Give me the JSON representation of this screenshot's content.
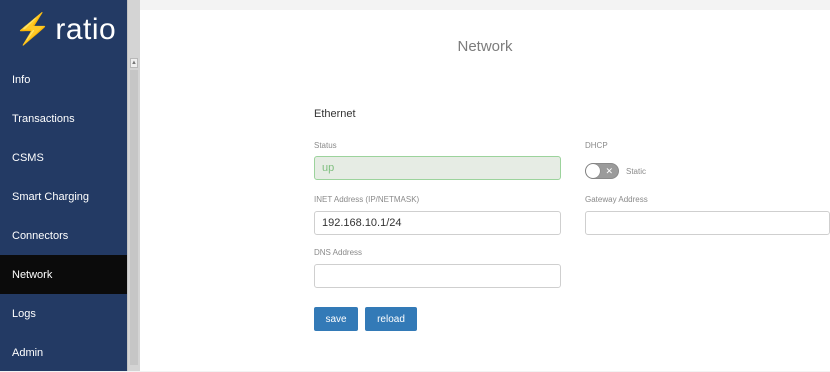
{
  "brand": {
    "bolt": "⚡",
    "name": "ratio"
  },
  "sidebar": {
    "items": [
      {
        "label": "Info"
      },
      {
        "label": "Transactions"
      },
      {
        "label": "CSMS"
      },
      {
        "label": "Smart Charging"
      },
      {
        "label": "Connectors"
      },
      {
        "label": "Network",
        "active": true
      },
      {
        "label": "Logs"
      },
      {
        "label": "Admin"
      }
    ]
  },
  "page": {
    "title": "Network"
  },
  "ethernet": {
    "section_title": "Ethernet",
    "status": {
      "label": "Status",
      "value": "up"
    },
    "dhcp": {
      "label": "DHCP",
      "toggle_label": "Static",
      "toggle_glyph": "✕",
      "enabled": false
    },
    "inet": {
      "label": "INET Address (IP/NETMASK)",
      "value": "192.168.10.1/24"
    },
    "gateway": {
      "label": "Gateway Address",
      "value": ""
    },
    "dns": {
      "label": "DNS Address",
      "value": ""
    }
  },
  "actions": {
    "save_label": "save",
    "reload_label": "reload"
  },
  "colors": {
    "sidebar_bg": "#233a64",
    "active_bg": "#0b0b0b",
    "button_bg": "#337ab7",
    "status_border": "#9cd39c"
  }
}
